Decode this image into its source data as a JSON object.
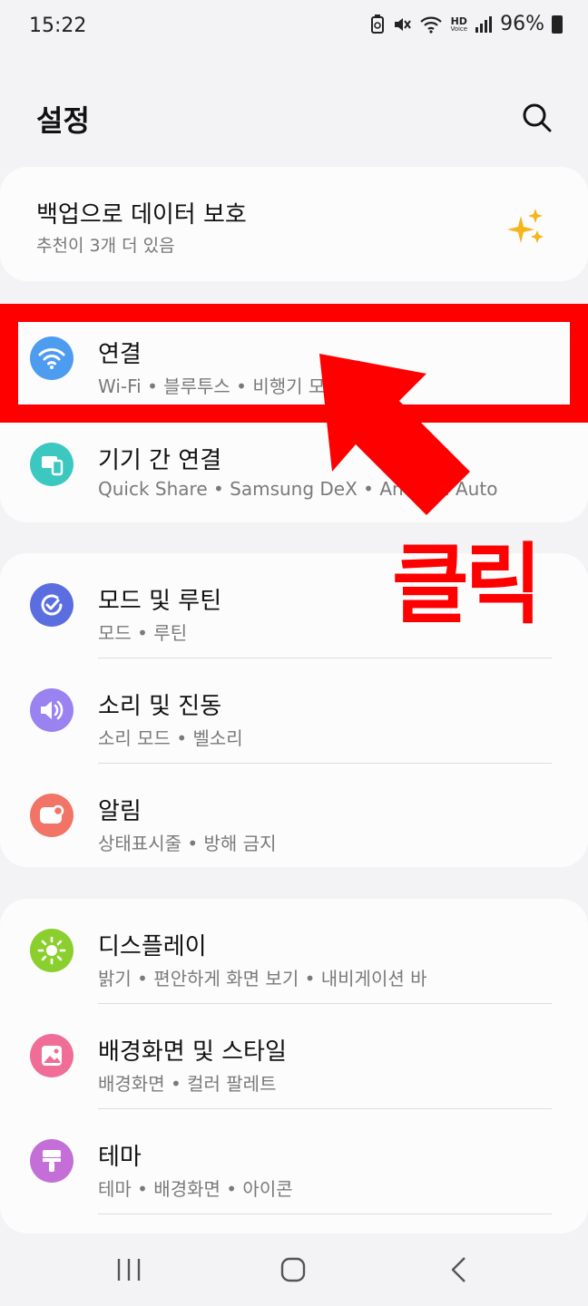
{
  "status": {
    "time": "15:22",
    "battery": "96%",
    "hd_label": "HD",
    "voice_label": "Voice"
  },
  "header": {
    "title": "설정",
    "search_icon": "search-icon"
  },
  "backup_card": {
    "title": "백업으로 데이터 보호",
    "subtitle": "추천이 3개 더 있음",
    "icon": "sparkle-icon",
    "icon_color": "#f5b41a"
  },
  "groups": [
    {
      "items": [
        {
          "title": "연결",
          "subtitle": "Wi-Fi  •  블루투스  •  비행기 모드",
          "icon": "wifi-icon",
          "color": "#4e9cf0"
        },
        {
          "title": "기기 간 연결",
          "subtitle": "Quick Share  •  Samsung DeX  •  Android Auto",
          "icon": "devices-icon",
          "color": "#3cc8c0"
        }
      ]
    },
    {
      "items": [
        {
          "title": "모드 및 루틴",
          "subtitle": "모드  •  루틴",
          "icon": "routine-icon",
          "color": "#5a6ee0"
        },
        {
          "title": "소리 및 진동",
          "subtitle": "소리 모드  •  벨소리",
          "icon": "volume-icon",
          "color": "#9a82f0"
        },
        {
          "title": "알림",
          "subtitle": "상태표시줄  •  방해 금지",
          "icon": "notification-icon",
          "color": "#f17466"
        }
      ]
    },
    {
      "items": [
        {
          "title": "디스플레이",
          "subtitle": "밝기  •  편안하게 화면 보기  •  내비게이션 바",
          "icon": "brightness-icon",
          "color": "#8bcf2f"
        },
        {
          "title": "배경화면 및 스타일",
          "subtitle": "배경화면  •  컬러 팔레트",
          "icon": "wallpaper-icon",
          "color": "#ef6d96"
        },
        {
          "title": "테마",
          "subtitle": "테마  •  배경화면  •  아이콘",
          "icon": "theme-icon",
          "color": "#c46fd8"
        }
      ]
    }
  ],
  "annotation": {
    "label": "클릭",
    "color": "#ff0000"
  },
  "nav": {
    "recents_icon": "recents-icon",
    "home_icon": "home-icon",
    "back_icon": "back-icon"
  }
}
